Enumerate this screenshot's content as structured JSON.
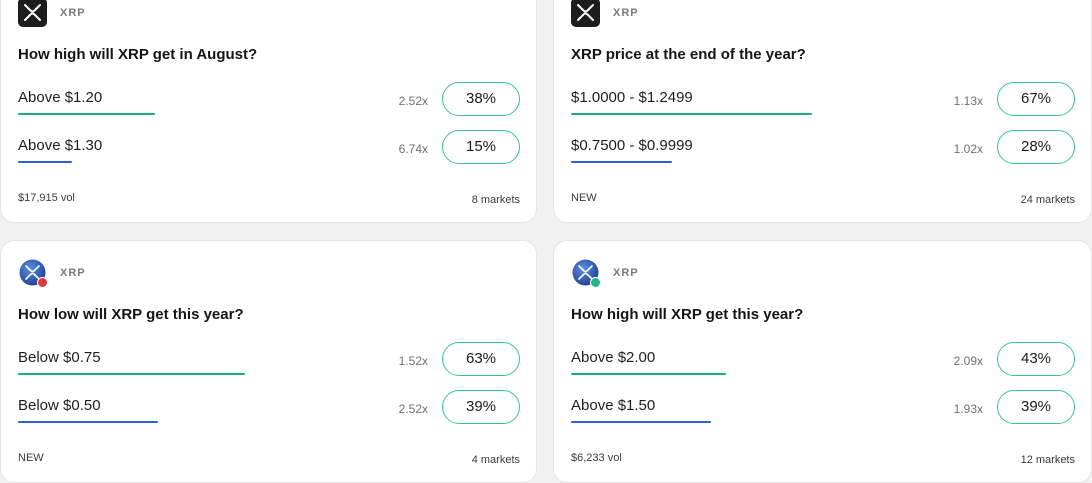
{
  "cards": [
    {
      "ticker": "XRP",
      "title": "How high will XRP get in August?",
      "icon": "xrp-logo-icon",
      "outcomes": [
        {
          "label": "Above $1.20",
          "multiplier": "2.52x",
          "percent": "38%",
          "fraction": 0.38
        },
        {
          "label": "Above $1.30",
          "multiplier": "6.74x",
          "percent": "15%",
          "fraction": 0.15
        }
      ],
      "footer_left": "$17,915 vol",
      "footer_right": "8 markets"
    },
    {
      "ticker": "XRP",
      "title": "XRP price at the end of the year?",
      "icon": "xrp-logo-icon",
      "outcomes": [
        {
          "label": "$1.0000 - $1.2499",
          "multiplier": "1.13x",
          "percent": "67%",
          "fraction": 0.67
        },
        {
          "label": "$0.7500 - $0.9999",
          "multiplier": "1.02x",
          "percent": "28%",
          "fraction": 0.28
        }
      ],
      "footer_left": "NEW",
      "footer_right": "24 markets"
    },
    {
      "ticker": "XRP",
      "title": "How low will XRP get this year?",
      "icon": "xrp-coin-icon",
      "badge": "down",
      "outcomes": [
        {
          "label": "Below $0.75",
          "multiplier": "1.52x",
          "percent": "63%",
          "fraction": 0.63
        },
        {
          "label": "Below $0.50",
          "multiplier": "2.52x",
          "percent": "39%",
          "fraction": 0.39
        }
      ],
      "footer_left": "NEW",
      "footer_right": "4 markets"
    },
    {
      "ticker": "XRP",
      "title": "How high will XRP get this year?",
      "icon": "xrp-coin-icon",
      "badge": "up",
      "outcomes": [
        {
          "label": "Above $2.00",
          "multiplier": "2.09x",
          "percent": "43%",
          "fraction": 0.43
        },
        {
          "label": "Above $1.50",
          "multiplier": "1.93x",
          "percent": "39%",
          "fraction": 0.39
        }
      ],
      "footer_left": "$6,233 vol",
      "footer_right": "12 markets"
    }
  ],
  "colors": {
    "accent_green": "#1aaf7f",
    "accent_blue": "#2c5ed8",
    "button_border": "#35c49a",
    "badge_down": "#e0383e",
    "badge_up": "#1fb884"
  }
}
